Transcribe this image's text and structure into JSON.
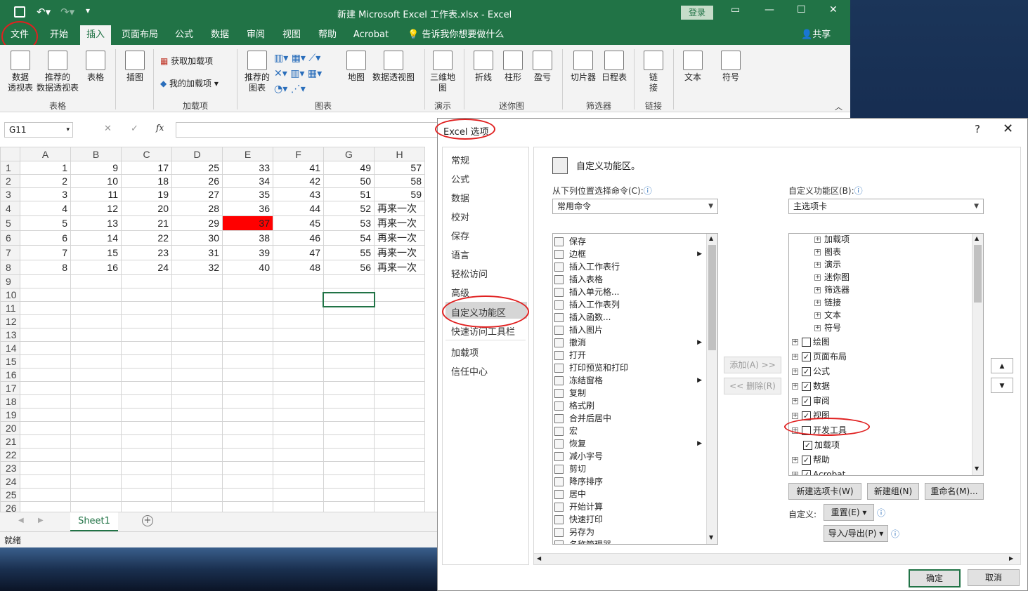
{
  "window": {
    "title": "新建 Microsoft Excel 工作表.xlsx  -  Excel",
    "login": "登录",
    "share": "共享",
    "tell_me": "告诉我你想要做什么"
  },
  "tabs": [
    "文件",
    "开始",
    "插入",
    "页面布局",
    "公式",
    "数据",
    "审阅",
    "视图",
    "帮助",
    "Acrobat"
  ],
  "active_tab": "插入",
  "ribbon": {
    "buttons": [
      "数据\n透视表",
      "推荐的\n数据透视表",
      "表格",
      "插图",
      "获取加载项",
      "我的加载项",
      "推荐的\n图表",
      "地图",
      "数据透视图",
      "三维地\n图",
      "折线",
      "柱形",
      "盈亏",
      "切片器",
      "日程表",
      "链\n接",
      "文本",
      "符号"
    ],
    "groups": [
      "表格",
      "加载项",
      "图表",
      "演示",
      "迷你图",
      "筛选器",
      "链接"
    ]
  },
  "formula_bar": {
    "name_box": "G11",
    "fx": "fx"
  },
  "sheet": {
    "columns": [
      "A",
      "B",
      "C",
      "D",
      "E",
      "F",
      "G",
      "H"
    ],
    "rows": [
      [
        "1",
        "9",
        "17",
        "25",
        "33",
        "41",
        "49",
        "57"
      ],
      [
        "2",
        "10",
        "18",
        "26",
        "34",
        "42",
        "50",
        "58"
      ],
      [
        "3",
        "11",
        "19",
        "27",
        "35",
        "43",
        "51",
        "59"
      ],
      [
        "4",
        "12",
        "20",
        "28",
        "36",
        "44",
        "52",
        "再来一次"
      ],
      [
        "5",
        "13",
        "21",
        "29",
        "37",
        "45",
        "53",
        "再来一次"
      ],
      [
        "6",
        "14",
        "22",
        "30",
        "38",
        "46",
        "54",
        "再来一次"
      ],
      [
        "7",
        "15",
        "23",
        "31",
        "39",
        "47",
        "55",
        "再来一次"
      ],
      [
        "8",
        "16",
        "24",
        "32",
        "40",
        "48",
        "56",
        "再来一次"
      ]
    ],
    "row_numbers": [
      "1",
      "2",
      "3",
      "4",
      "5",
      "6",
      "7",
      "8",
      "9",
      "10",
      "11",
      "12",
      "13",
      "14",
      "15",
      "16",
      "17",
      "18",
      "19",
      "20",
      "21",
      "22",
      "23",
      "24",
      "25",
      "26"
    ],
    "highlight_color": "#ff0000",
    "tab": "Sheet1",
    "status": "就绪"
  },
  "dialog": {
    "title": "Excel 选项",
    "help": "?",
    "close": "✕",
    "nav": [
      "常规",
      "公式",
      "数据",
      "校对",
      "保存",
      "语言",
      "轻松访问",
      "高级",
      "自定义功能区",
      "快速访问工具栏",
      "加载项",
      "信任中心"
    ],
    "selected_nav": "自定义功能区",
    "heading": "自定义功能区。",
    "choose_label": "从下列位置选择命令(C):",
    "choose_value": "常用命令",
    "customize_label": "自定义功能区(B):",
    "customize_value": "主选项卡",
    "commands": [
      "保存",
      "边框",
      "插入工作表行",
      "插入表格",
      "插入单元格...",
      "插入工作表列",
      "插入函数...",
      "插入图片",
      "撤消",
      "打开",
      "打印预览和打印",
      "冻结窗格",
      "复制",
      "格式刷",
      "合并后居中",
      "宏",
      "恢复",
      "减小字号",
      "剪切",
      "降序排序",
      "居中",
      "开始计算",
      "快速打印",
      "另存为",
      "名称管理器"
    ],
    "tree_sub": [
      "加载项",
      "图表",
      "演示",
      "迷你图",
      "筛选器",
      "链接",
      "文本",
      "符号"
    ],
    "tree_main": [
      {
        "label": "绘图",
        "checked": false
      },
      {
        "label": "页面布局",
        "checked": true
      },
      {
        "label": "公式",
        "checked": true
      },
      {
        "label": "数据",
        "checked": true
      },
      {
        "label": "审阅",
        "checked": true
      },
      {
        "label": "视图",
        "checked": true
      },
      {
        "label": "开发工具",
        "checked": false
      },
      {
        "label": "加载项",
        "checked": true
      },
      {
        "label": "帮助",
        "checked": true
      },
      {
        "label": "Acrobat",
        "checked": true
      }
    ],
    "add": "添加(A) >>",
    "remove": "<< 删除(R)",
    "new_tab": "新建选项卡(W)",
    "new_group": "新建组(N)",
    "rename": "重命名(M)...",
    "custom_label": "自定义:",
    "reset": "重置(E) ▾",
    "import_export": "导入/导出(P) ▾",
    "ok": "确定",
    "cancel": "取消",
    "annotation_color": "#e02020"
  }
}
